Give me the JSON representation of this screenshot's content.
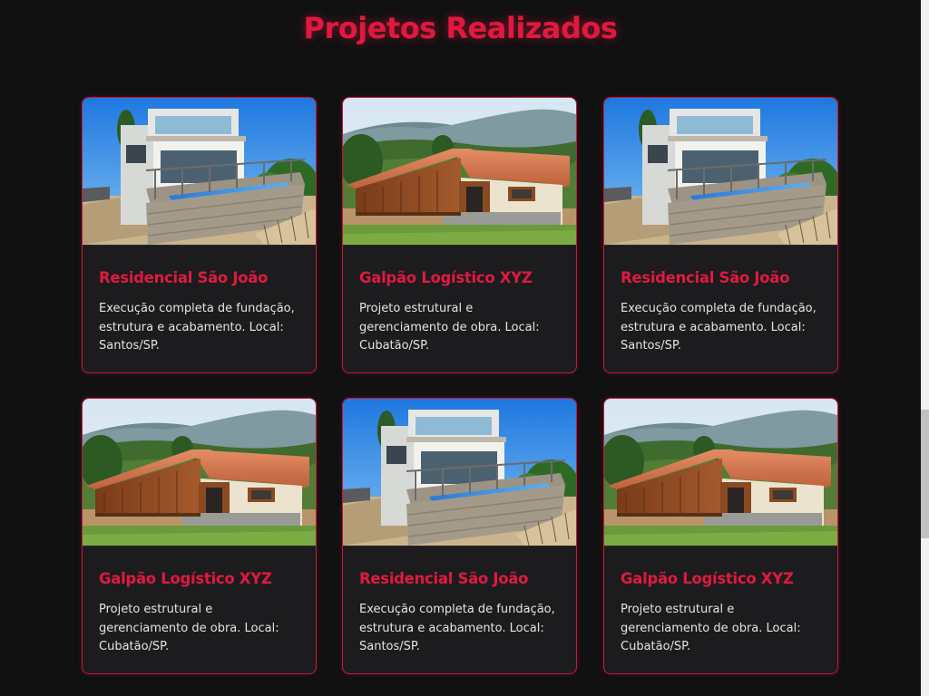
{
  "section": {
    "title": "Projetos Realizados"
  },
  "projects": [
    {
      "image": "house-with-pool-photo",
      "title": "Residencial São João",
      "description": "Execução completa de fundação, estrutura e acabamento. Local: Santos/SP."
    },
    {
      "image": "wooden-chalet-photo",
      "title": "Galpão Logístico XYZ",
      "description": "Projeto estrutural e gerenciamento de obra. Local: Cubatão/SP."
    },
    {
      "image": "house-with-pool-photo",
      "title": "Residencial São João",
      "description": "Execução completa de fundação, estrutura e acabamento. Local: Santos/SP."
    },
    {
      "image": "wooden-chalet-photo",
      "title": "Galpão Logístico XYZ",
      "description": "Projeto estrutural e gerenciamento de obra. Local: Cubatão/SP."
    },
    {
      "image": "house-with-pool-photo",
      "title": "Residencial São João",
      "description": "Execução completa de fundação, estrutura e acabamento. Local: Santos/SP."
    },
    {
      "image": "wooden-chalet-photo",
      "title": "Galpão Logístico XYZ",
      "description": "Projeto estrutural e gerenciamento de obra. Local: Cubatão/SP."
    }
  ],
  "colors": {
    "accent": "#e0193f",
    "background": "#111112",
    "card": "#1c1c1e",
    "text": "#e4e4e4"
  }
}
